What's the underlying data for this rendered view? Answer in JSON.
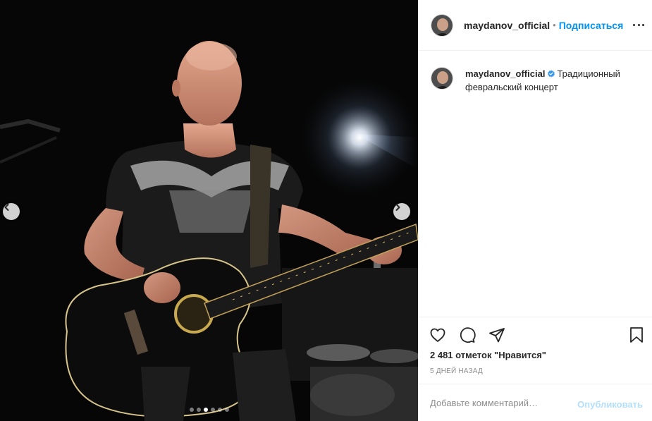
{
  "post": {
    "username": "maydanov_official",
    "separator": "•",
    "follow_label": "Подписаться",
    "more_icon": "more-horizontal-icon",
    "caption_text": "Традиционный февральский концерт",
    "likes_text": "2 481 отметок \"Нравится\"",
    "time_text": "5 дней назад",
    "verified": true
  },
  "media": {
    "description": "concert-photo-guitarist",
    "carousel_total": 6,
    "carousel_active_index": 3,
    "prev_icon": "chevron-left-icon",
    "next_icon": "chevron-right-icon"
  },
  "comment": {
    "placeholder": "Добавьте комментарий…",
    "post_label": "Опубликовать"
  },
  "icons": {
    "like": "heart-icon",
    "comment": "comment-icon",
    "share": "paper-plane-icon",
    "save": "bookmark-icon"
  },
  "colors": {
    "link": "#0095f6",
    "post_disabled": "#b2dffc",
    "verified": "#3897f0"
  }
}
